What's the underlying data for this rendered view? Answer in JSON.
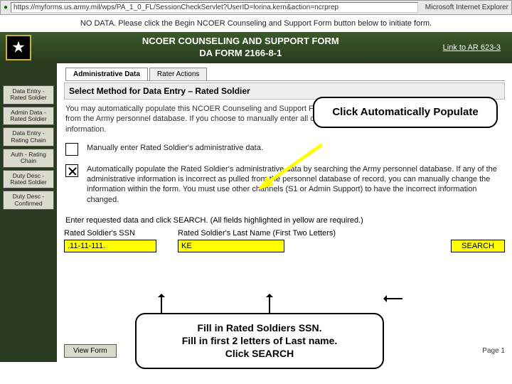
{
  "address_bar": {
    "url": "https://myforms.us.army.mil/wps/PA_1_0_FL/SessionCheckServlet?UserID=lorina.kern&action=ncrprep",
    "browser_title": "Microsoft Internet Explorer"
  },
  "banner": {
    "no_data": "NO DATA. Please click the Begin NCOER Counseling and Support Form button below to initiate form."
  },
  "header": {
    "title_line1": "NCOER COUNSELING AND SUPPORT FORM",
    "title_line2": "DA FORM 2166-8-1",
    "link": "Link to AR 623-3"
  },
  "tabs": [
    {
      "label": "Administrative Data",
      "active": true
    },
    {
      "label": "Rater Actions",
      "active": false
    }
  ],
  "sidebar": {
    "items": [
      "Data Entry - Rated Soldier",
      "Admin Data - Rated Soldier",
      "Data Entry - Rating Chain",
      "Auth - Rating Chain",
      "Duty Desc - Rated Soldier",
      "Duty Desc - Confirmed"
    ]
  },
  "main": {
    "section_title": "Select Method for Data Entry – Rated Soldier",
    "intro": "You may automatically populate this NCOER Counseling and Support Form with the Rated Soldier's personnel information from the Army personnel database. If you choose to manually enter all data you are required to manually enter all required information.",
    "opt1": "Manually enter Rated Soldier's administrative data.",
    "opt2": "Automatically populate the Rated Soldier's administrative data by searching the Army personnel database. If any of the administrative information is incorrect as pulled from the personnel database of record, you can manually change the information within the form. You must use other channels (S1 or Admin Support) to have the incorrect information changed.",
    "req_note": "Enter requested data and click SEARCH.  (All fields highlighted in yellow are required.)",
    "ssn_label": "Rated Soldier's SSN",
    "ssn_value": ".11-11-111.",
    "lname_label": "Rated Soldier's Last Name (First Two Letters)",
    "lname_value": "KE",
    "search_label": "SEARCH",
    "view_form": "View Form",
    "page": "Page 1"
  },
  "callouts": {
    "c1": "Click Automatically Populate",
    "c2_l1": "Fill in Rated Soldiers SSN.",
    "c2_l2": "Fill in first 2 letters of Last name.",
    "c2_l3": "Click SEARCH"
  }
}
